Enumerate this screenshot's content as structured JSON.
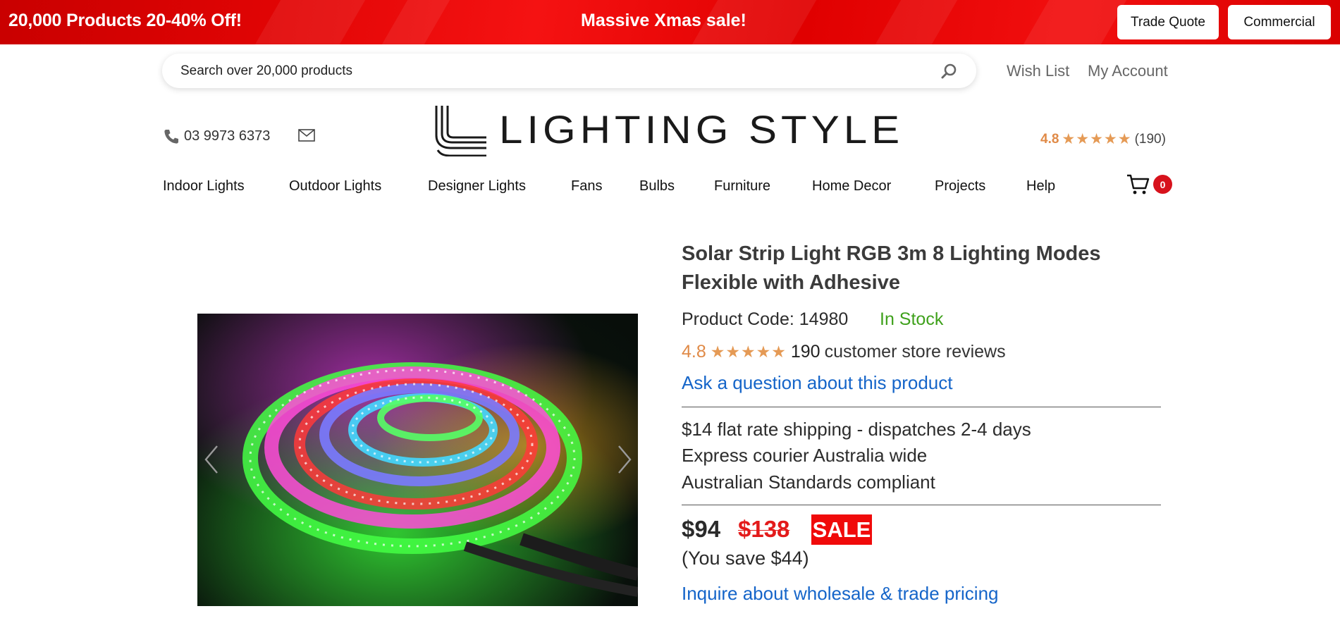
{
  "promo": {
    "left_text": "20,000 Products 20-40% Off!",
    "center_text": "Massive Xmas sale!",
    "trade_quote_label": "Trade Quote",
    "commercial_label": "Commercial",
    "color": "#e00404"
  },
  "search": {
    "placeholder": "Search over 20,000 products",
    "icon": "search-icon"
  },
  "top_links": {
    "wish_list": "Wish List",
    "my_account": "My Account"
  },
  "header": {
    "phone": "03 9973 6373",
    "phone_icon": "phone-icon",
    "mail_icon": "mail-icon",
    "logo_text": "LIGHTING STYLE",
    "rating": {
      "score": "4.8",
      "stars": "★★★★★",
      "count": "(190)",
      "star_color": "#e59a55"
    }
  },
  "nav": {
    "items": [
      "Indoor Lights",
      "Outdoor Lights",
      "Designer Lights",
      "Fans",
      "Bulbs",
      "Furniture",
      "Home Decor",
      "Projects",
      "Help"
    ],
    "cart_count": "0",
    "cart_icon": "cart-icon"
  },
  "product": {
    "title": "Solar Strip Light RGB 3m 8 Lighting Modes Flexible with Adhesive",
    "code_label": "Product Code: 14980",
    "stock": "In Stock",
    "stock_color": "#3fa11c",
    "rating_score": "4.8",
    "rating_stars": "★★★★★",
    "review_count": "190",
    "review_label": "customer store reviews",
    "ask_link": "Ask a question about this product",
    "shipping": [
      "$14 flat rate shipping - dispatches 2-4 days",
      "Express courier Australia wide",
      "Australian Standards compliant"
    ],
    "price_now": "$94",
    "price_was": "$138",
    "sale_label": "SALE",
    "save_text": "(You save $44)",
    "wholesale_link": "Inquire about wholesale & trade pricing",
    "link_color": "#1565c9",
    "sale_color": "#f00a0a"
  }
}
